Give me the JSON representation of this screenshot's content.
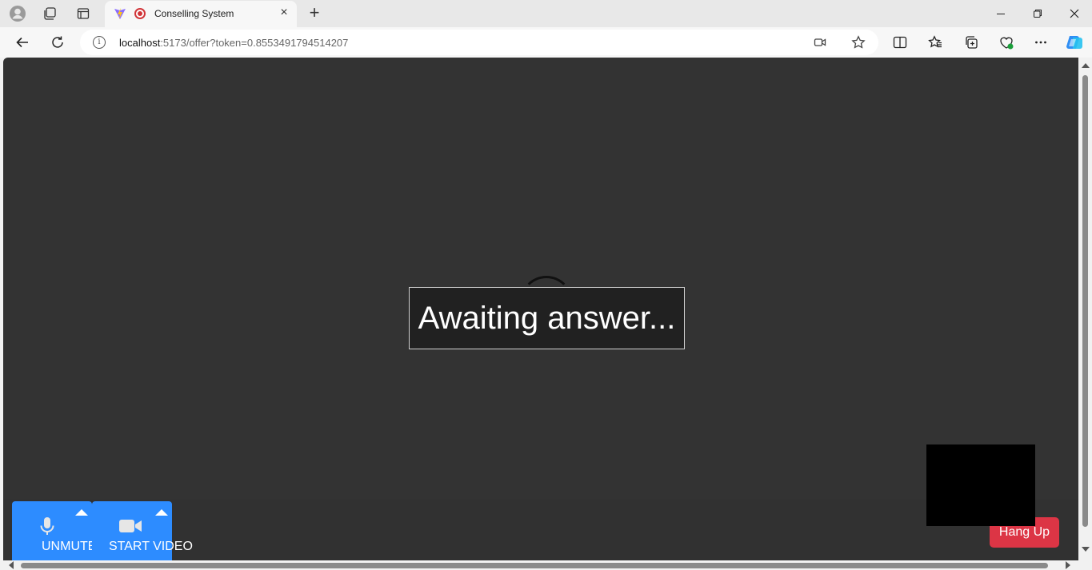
{
  "browser": {
    "tab_title": "Conselling System",
    "tab_close": "×",
    "new_tab": "+",
    "address": {
      "host": "localhost",
      "path": ":5173/offer?token=0.8553491794514207"
    }
  },
  "icons": {
    "profile": "profile-icon",
    "workspaces": "workspaces-icon",
    "tab_actions": "tab-actions-icon",
    "back": "back-icon",
    "refresh": "refresh-icon",
    "info": "info-icon",
    "camera": "camera-icon",
    "favorite": "star-icon",
    "split": "split-screen-icon",
    "favorites": "favorites-icon",
    "collections": "collections-icon",
    "extensions": "browser-essentials-icon",
    "more": "more-icon",
    "copilot": "copilot-icon"
  },
  "call": {
    "status": "Awaiting answer...",
    "mute_label": "UNMUTE",
    "video_label": "START VIDEO",
    "hangup_label": "Hang Up"
  },
  "colors": {
    "background": "#333333",
    "control_blue": "#2d8cff",
    "hangup_red": "#dc3545"
  }
}
